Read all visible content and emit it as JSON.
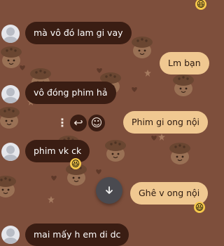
{
  "colors": {
    "background": "#7e4f3c",
    "incoming_bubble": "#3a1d13",
    "outgoing_bubble": "#f0c891",
    "reaction_badge": "#f6c84b"
  },
  "messages": [
    {
      "direction": "incoming",
      "text": "mà vô đó lam gi vay"
    },
    {
      "direction": "outgoing",
      "text": "Lm bạn"
    },
    {
      "direction": "incoming",
      "text": "vô đóng phim hả"
    },
    {
      "direction": "outgoing",
      "text": "Phim gi ong nội"
    },
    {
      "direction": "incoming",
      "text": "phim vk ck",
      "reaction": "😆"
    },
    {
      "direction": "outgoing",
      "text": "Ghê v ong nội",
      "reaction": "😆"
    },
    {
      "direction": "incoming",
      "text": "mai mấy h em di dc"
    }
  ],
  "top_reaction": "😆",
  "message_actions": {
    "more_icon": "more-vertical-icon",
    "reply_icon": "reply-icon",
    "react_icon": "smile-icon",
    "more_glyph": "⋮",
    "reply_glyph": "↩",
    "react_glyph": "☺"
  },
  "scroll_button": {
    "icon": "arrow-down-icon"
  }
}
